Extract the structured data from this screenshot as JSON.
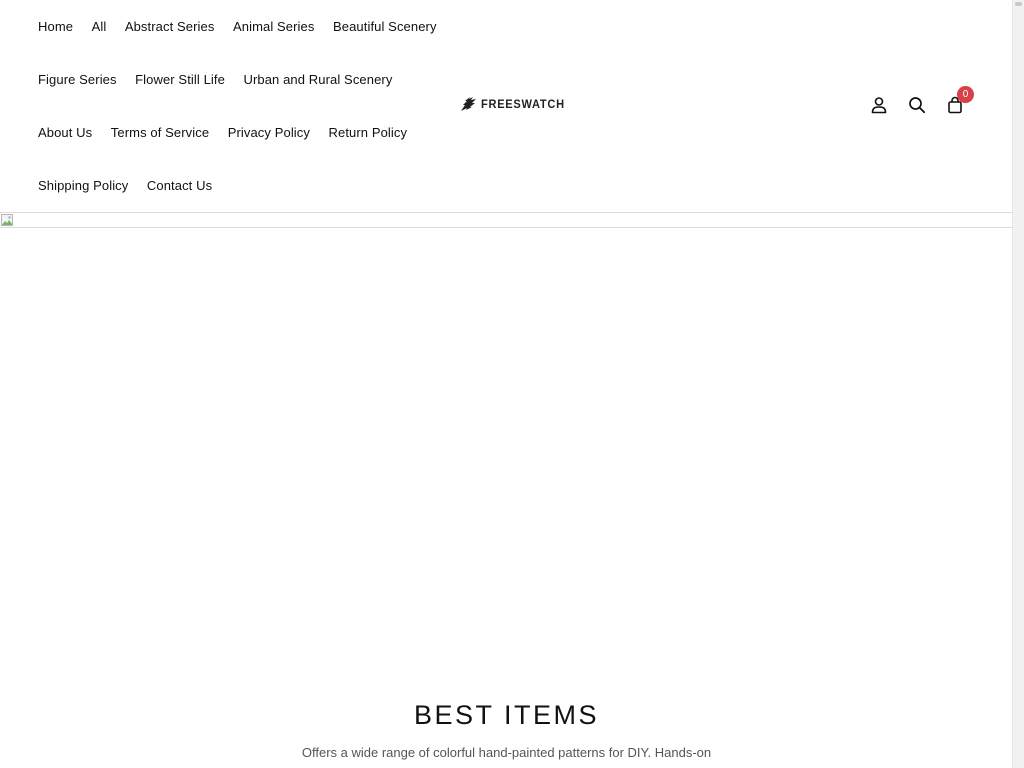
{
  "nav": {
    "rows": [
      [
        "Home",
        "All",
        "Abstract Series",
        "Animal Series",
        "Beautiful Scenery"
      ],
      [
        "Figure Series",
        "Flower Still Life",
        "Urban and Rural Scenery"
      ],
      [
        "About Us",
        "Terms of Service",
        "Privacy Policy",
        "Return Policy"
      ],
      [
        "Shipping Policy",
        "Contact Us"
      ]
    ]
  },
  "logo": {
    "text": "FREESWATCH",
    "icon": "brush-stroke-icon"
  },
  "header_icons": {
    "account": "user-icon",
    "search": "search-icon",
    "cart": "shopping-bag-icon",
    "cart_count": "0",
    "badge_color": "#d9414a"
  },
  "hero": {
    "image": "broken-image-icon"
  },
  "section": {
    "title": "BEST ITEMS",
    "description": "Offers a wide range of colorful hand-painted patterns for DIY. Hands-on"
  }
}
